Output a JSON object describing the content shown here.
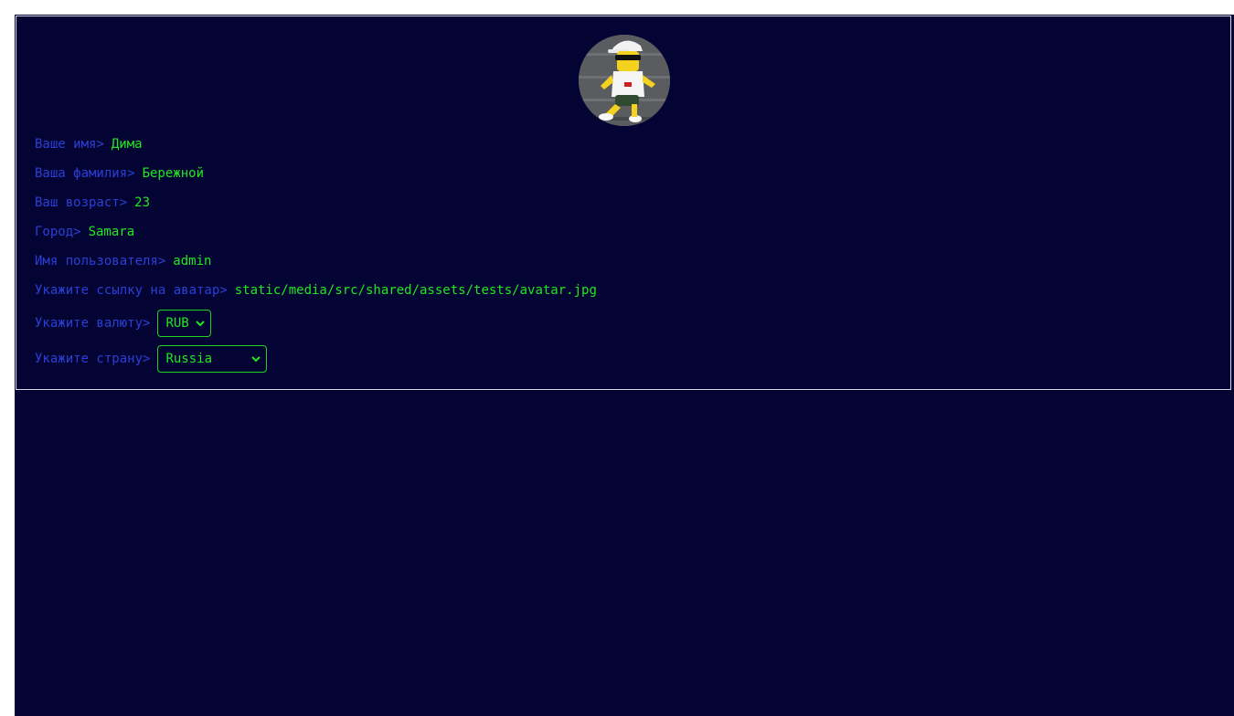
{
  "profile": {
    "first_name_label": "Ваше имя>",
    "first_name": "Дима",
    "last_name_label": "Ваша фамилия>",
    "last_name": "Бережной",
    "age_label": "Ваш возраст>",
    "age": "23",
    "city_label": "Город>",
    "city": "Samara",
    "username_label": "Имя пользователя>",
    "username": "admin",
    "avatar_label": "Укажите ссылку на аватар>",
    "avatar_url": "static/media/src/shared/assets/tests/avatar.jpg",
    "currency_label": "Укажите валюту>",
    "currency": "RUB",
    "country_label": "Укажите страну>",
    "country": "Russia"
  },
  "icons": {
    "avatar": "avatar-image",
    "currency_chevron": "chevron-down-icon",
    "country_chevron": "chevron-down-icon"
  },
  "colors": {
    "background": "#040434",
    "label": "#2b3fd6",
    "value": "#1fe81f",
    "border": "#d8d8e0"
  }
}
